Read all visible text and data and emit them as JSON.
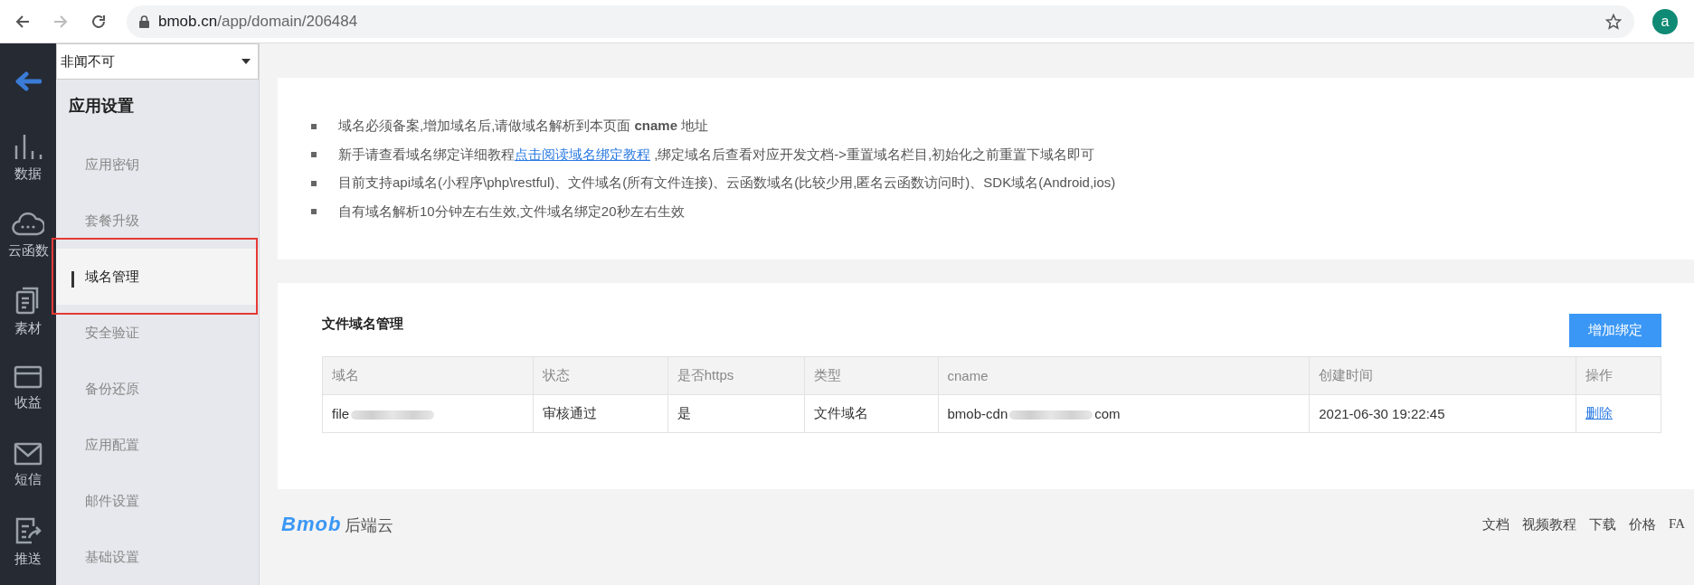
{
  "browser": {
    "url_host": "bmob.cn",
    "url_path": "/app/domain/206484",
    "forward_disabled": true,
    "avatar_letter": "a"
  },
  "rail": [
    {
      "kind": "back"
    },
    {
      "kind": "chart",
      "label": "数据"
    },
    {
      "kind": "cloud",
      "label": "云函数"
    },
    {
      "kind": "docs",
      "label": "素材"
    },
    {
      "kind": "card",
      "label": "收益"
    },
    {
      "kind": "mail",
      "label": "短信"
    },
    {
      "kind": "push",
      "label": "推送"
    }
  ],
  "sidebar": {
    "app_select": {
      "value": "非闻不可"
    },
    "title": "应用设置",
    "items": [
      {
        "label": "应用密钥",
        "selected": false,
        "annotated": false
      },
      {
        "label": "套餐升级",
        "selected": false,
        "annotated": false
      },
      {
        "label": "域名管理",
        "selected": true,
        "annotated": true
      },
      {
        "label": "安全验证",
        "selected": false,
        "annotated": false
      },
      {
        "label": "备份还原",
        "selected": false,
        "annotated": false
      },
      {
        "label": "应用配置",
        "selected": false,
        "annotated": false
      },
      {
        "label": "邮件设置",
        "selected": false,
        "annotated": false
      },
      {
        "label": "基础设置",
        "selected": false,
        "annotated": false
      }
    ]
  },
  "notes": [
    {
      "kind": "text",
      "text": "域名必须备案,增加域名后,请做域名解析到本页面 **cname** 地址"
    },
    {
      "kind": "link",
      "before": "新手请查看域名绑定详细教程",
      "link": "点击阅读域名绑定教程",
      "after": " ,绑定域名后查看对应开发文档->重置域名栏目,初始化之前重置下域名即可"
    },
    {
      "kind": "text",
      "text": "目前支持api域名(小程序\\php\\restful)、文件域名(所有文件连接)、云函数域名(比较少用,匿名云函数访问时)、SDK域名(Android,ios)"
    },
    {
      "kind": "text",
      "text": "自有域名解析10分钟左右生效,文件域名绑定20秒左右生效"
    }
  ],
  "domains": {
    "title": "文件域名管理",
    "add_button": "增加绑定",
    "columns": [
      "域名",
      "状态",
      "是否https",
      "类型",
      "cname",
      "创建时间",
      "操作"
    ],
    "rows": [
      {
        "domain": "file",
        "status": "审核通过",
        "https": "是",
        "type": "文件域名",
        "cname_start": "bmob-cdn",
        "cname_end": "com",
        "created": "2021-06-30 19:22:45",
        "action": "删除"
      }
    ]
  },
  "footer": {
    "logo": "Bmob",
    "logo_suffix": "后端云",
    "links": [
      "文档",
      "视频教程",
      "下载",
      "价格",
      "FA"
    ]
  }
}
